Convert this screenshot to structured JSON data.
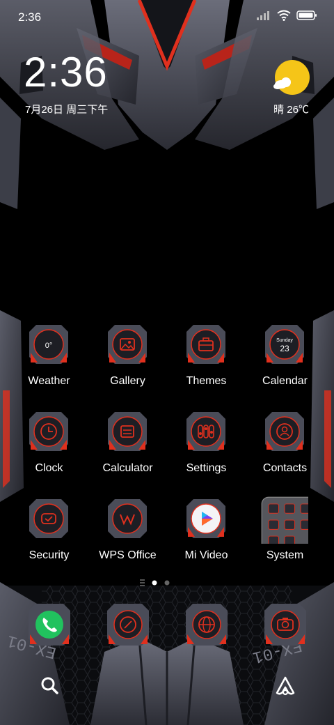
{
  "status_bar": {
    "time": "2:36"
  },
  "clock_widget": {
    "time": "2:36",
    "date": "7月26日 周三下午"
  },
  "weather_widget": {
    "text": "晴 26℃"
  },
  "apps": [
    {
      "name": "weather",
      "label": "Weather",
      "icon": "weather-icon",
      "badge": "0°"
    },
    {
      "name": "gallery",
      "label": "Gallery",
      "icon": "gallery-icon"
    },
    {
      "name": "themes",
      "label": "Themes",
      "icon": "briefcase-icon"
    },
    {
      "name": "calendar",
      "label": "Calendar",
      "icon": "calendar-icon",
      "day_name": "Sunday",
      "day_num": "23"
    },
    {
      "name": "clock",
      "label": "Clock",
      "icon": "clock-icon"
    },
    {
      "name": "calculator",
      "label": "Calculator",
      "icon": "calculator-icon"
    },
    {
      "name": "settings",
      "label": "Settings",
      "icon": "sliders-icon"
    },
    {
      "name": "contacts",
      "label": "Contacts",
      "icon": "person-icon"
    },
    {
      "name": "security",
      "label": "Security",
      "icon": "shield-check-icon"
    },
    {
      "name": "wps-office",
      "label": "WPS Office",
      "icon": "wps-icon"
    },
    {
      "name": "mi-video",
      "label": "Mi Video",
      "icon": "play-icon"
    },
    {
      "name": "system",
      "label": "System",
      "icon": "folder-icon"
    }
  ],
  "dock": [
    {
      "name": "phone",
      "icon": "phone-icon"
    },
    {
      "name": "messages",
      "icon": "message-icon"
    },
    {
      "name": "browser",
      "icon": "globe-icon"
    },
    {
      "name": "camera",
      "icon": "camera-icon"
    }
  ],
  "wallpaper_marks": {
    "left": "EX-01",
    "right": "EX-01"
  },
  "colors": {
    "accent": "#e0301e",
    "tile": "#2a2b33",
    "tile_edge": "#4a4c58"
  }
}
